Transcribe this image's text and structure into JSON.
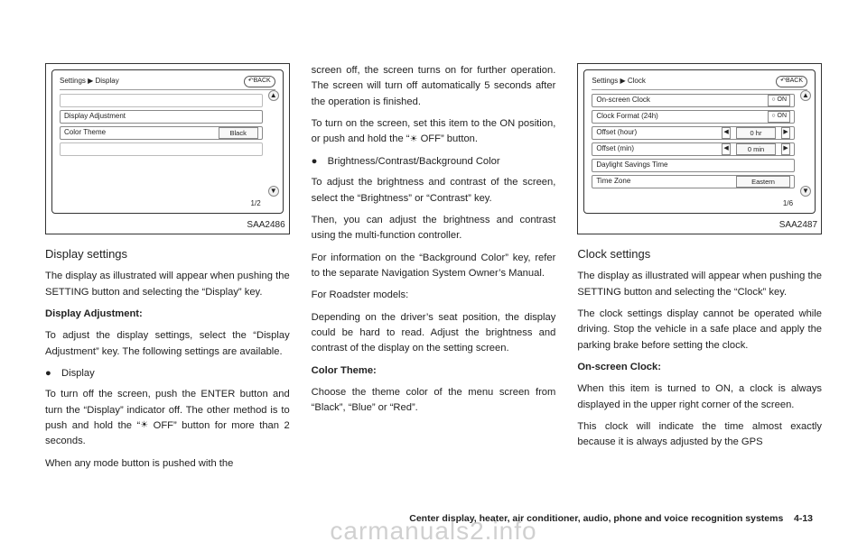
{
  "fig1": {
    "label": "SAA2486",
    "breadcrumb": "Settings ▶ Display",
    "back": "↶BACK",
    "rows": {
      "blank1": "",
      "r1": "Display Adjustment",
      "r2_label": "Color Theme",
      "r2_value": "Black",
      "blank2": ""
    },
    "pager": "1/2"
  },
  "fig2": {
    "label": "SAA2487",
    "breadcrumb": "Settings ▶ Clock",
    "back": "↶BACK",
    "rows": {
      "r1_label": "On-screen Clock",
      "r1_value": "○ ON",
      "r2_label": "Clock Format (24h)",
      "r2_value": "○ ON",
      "r3_label": "Offset (hour)",
      "r3_value": "0 hr",
      "r4_label": "Offset (min)",
      "r4_value": "0 min",
      "r5_label": "Daylight Savings Time",
      "r6_label": "Time Zone",
      "r6_value": "Eastern"
    },
    "pager": "1/6"
  },
  "col1": {
    "h_display_settings": "Display settings",
    "p1": "The display as illustrated will appear when pushing the SETTING button and selecting the “Display” key.",
    "h_display_adj": "Display Adjustment:",
    "p2": "To adjust the display settings, select the “Display Adjustment” key. The following settings are available.",
    "b1": "Display",
    "p3": "To turn off the screen, push the ENTER button and turn the “Display” indicator off. The other method is to push and hold the “",
    "p3_off": " OFF” button for more than 2 seconds.",
    "p4": "When any mode button is pushed with the"
  },
  "col2": {
    "p1": "screen off, the screen turns on for further operation. The screen will turn off automatically 5 seconds after the operation is finished.",
    "p2a": "To turn on the screen, set this item to the ON position, or push and hold the “",
    "p2b": " OFF” button.",
    "b1": "Brightness/Contrast/Background Color",
    "p3": "To adjust the brightness and contrast of the screen, select the “Brightness” or “Contrast” key.",
    "p4": "Then, you can adjust the brightness and contrast using the multi-function controller.",
    "p5": "For information on the “Background Color” key, refer to the separate Navigation System Owner’s Manual.",
    "p6": "For Roadster models:",
    "p7": "Depending on the driver’s seat position, the display could be hard to read. Adjust the brightness and contrast of the display on the setting screen.",
    "h_color": "Color Theme:",
    "p8": "Choose the theme color of the menu screen from “Black”, “Blue” or “Red”."
  },
  "col3": {
    "h_clock": "Clock settings",
    "p1": "The display as illustrated will appear when pushing the SETTING button and selecting the “Clock” key.",
    "p2": "The clock settings display cannot be operated while driving. Stop the vehicle in a safe place and apply the parking brake before setting the clock.",
    "h_onscreen": "On-screen Clock:",
    "p3": "When this item is turned to ON, a clock is always displayed in the upper right corner of the screen.",
    "p4": "This clock will indicate the time almost exactly because it is always adjusted by the GPS"
  },
  "footer": {
    "section": "Center display, heater, air conditioner, audio, phone and voice recognition systems",
    "page": "4-13"
  },
  "watermark": "carmanuals2.info",
  "icons": {
    "sun": "☀"
  }
}
